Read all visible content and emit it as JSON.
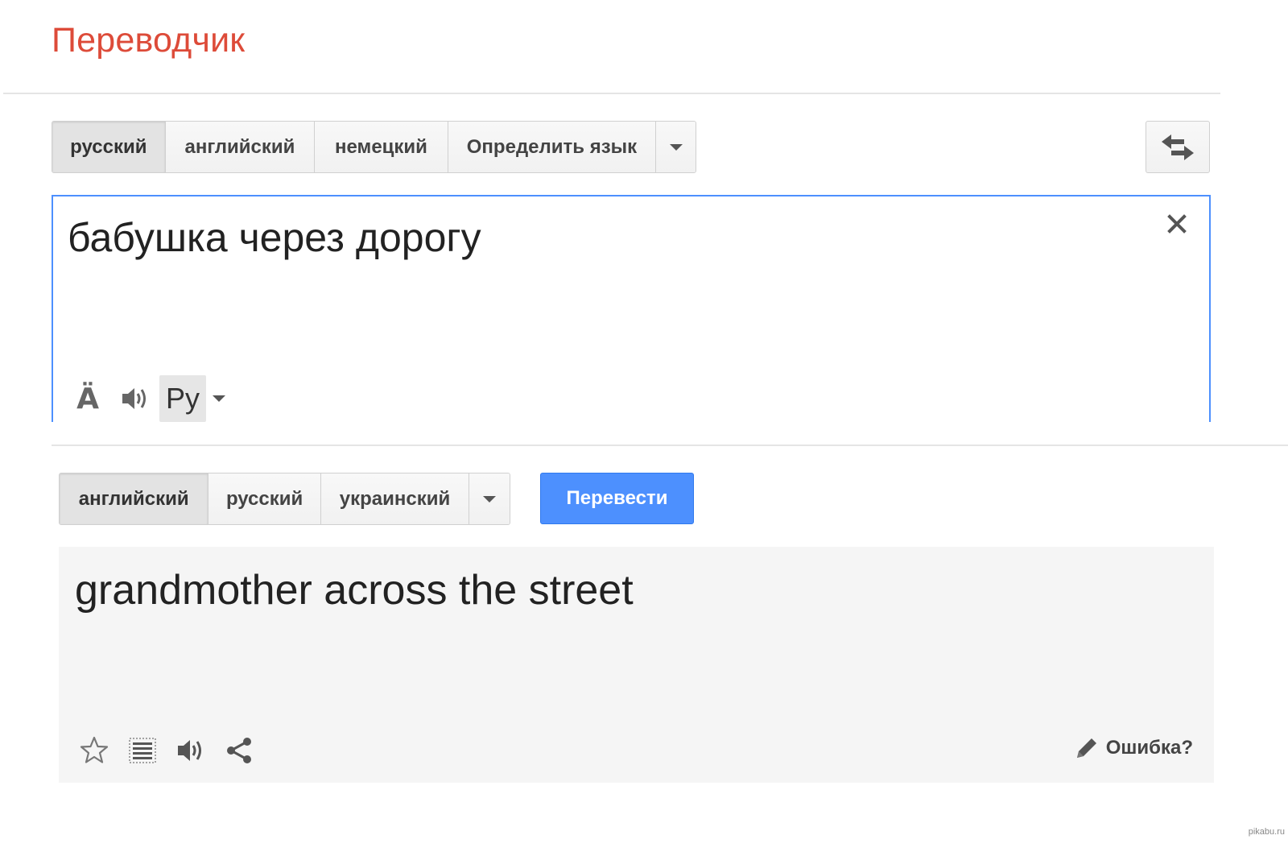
{
  "app": {
    "title": "Переводчик"
  },
  "source": {
    "languages": [
      "русский",
      "английский",
      "немецкий",
      "Определить язык"
    ],
    "selected_language": "русский",
    "text": "бабушка через дорогу",
    "tools": {
      "special_chars_label": "Ä",
      "ime_label": "Ру"
    },
    "icons": {
      "swap": "swap-languages-icon",
      "clear": "close-icon",
      "listen": "speaker-icon",
      "dropdown": "chevron-down-icon"
    }
  },
  "target": {
    "languages": [
      "английский",
      "русский",
      "украинский"
    ],
    "selected_language": "английский",
    "translate_label": "Перевести",
    "text": "grandmother across the street",
    "report_error_label": "Ошибка?",
    "icons": {
      "star": "star-icon",
      "list": "list-icon",
      "listen": "speaker-icon",
      "share": "share-icon",
      "pencil": "pencil-icon"
    }
  },
  "footer": {
    "watermark": "pikabu.ru"
  },
  "colors": {
    "title": "#dd4b39",
    "accent_blue": "#4d90fe",
    "result_bg": "#f5f5f5"
  }
}
